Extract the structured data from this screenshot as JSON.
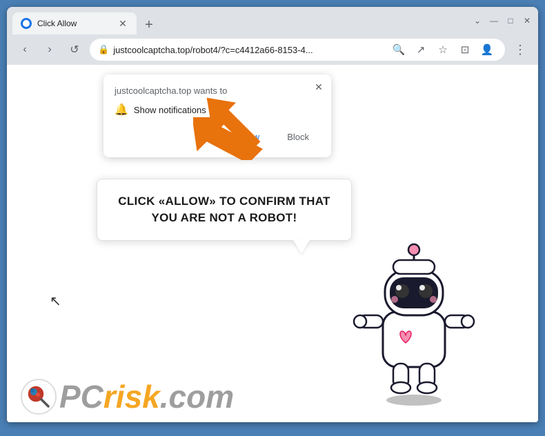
{
  "browser": {
    "tab_title": "Click Allow",
    "address": "justcoolcaptcha.top/robot4/?c=c4412a66-8153-4...",
    "new_tab_label": "+",
    "nav": {
      "back": "‹",
      "forward": "›",
      "reload": "↺"
    },
    "window_controls": {
      "chevron": "⌄",
      "minimize": "—",
      "maximize": "□",
      "close": "✕"
    }
  },
  "notification_popup": {
    "title": "justcoolcaptcha.top wants to",
    "bell_label": "Show notifications",
    "allow_label": "Allow",
    "block_label": "Block",
    "close_label": "✕"
  },
  "speech_bubble": {
    "text": "CLICK «ALLOW» TO CONFIRM THAT YOU ARE NOT A ROBOT!"
  },
  "pcrisk": {
    "pc_text": "PC",
    "risk_text": "risk",
    "dot_com": ".com"
  },
  "icons": {
    "lock": "🔒",
    "search": "🔍",
    "share": "↗",
    "star": "☆",
    "sidebar": "⊡",
    "profile": "👤",
    "menu": "⋮"
  }
}
